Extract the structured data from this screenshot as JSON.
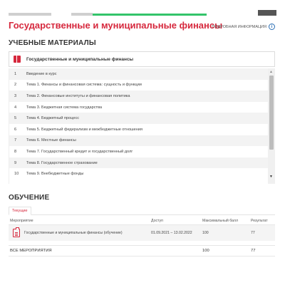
{
  "header": {
    "title": "Государственные и муниципальные финансы",
    "more_info": "ПОДРОБНАЯ ИНФОРМАЦИЯ"
  },
  "materials": {
    "heading": "УЧЕБНЫЕ МАТЕРИАЛЫ",
    "course_label": "Государственные и муниципальные финансы",
    "topics": [
      {
        "num": "1",
        "title": "Введение в курс"
      },
      {
        "num": "2",
        "title": "Тема 1. Финансы и финансовая система: сущность и функции"
      },
      {
        "num": "3",
        "title": "Тема 2. Финансовые институты и финансовая политика"
      },
      {
        "num": "4",
        "title": "Тема 3. Бюджетная система государства"
      },
      {
        "num": "5",
        "title": "Тема 4. Бюджетный процесс"
      },
      {
        "num": "6",
        "title": "Тема 5. Бюджетный федерализм и межбюджетные отношения"
      },
      {
        "num": "7",
        "title": "Тема 6. Местные финансы"
      },
      {
        "num": "8",
        "title": "Тема 7. Государственный кредит и государственный долг"
      },
      {
        "num": "9",
        "title": "Тема 8. Государственное страхование"
      },
      {
        "num": "10",
        "title": "Тема 9. Внебюджетные фонды"
      }
    ]
  },
  "learning": {
    "heading": "ОБУЧЕНИЕ",
    "tab_current": "Текущие",
    "columns": {
      "event": "Мероприятие",
      "access": "Доступ",
      "max_score": "Максимальный балл",
      "result": "Результат"
    },
    "rows": [
      {
        "event": "Государственные и муниципальные финансы (обучение)",
        "access": "01.09.2021 – 13.02.2022",
        "max_score": "100",
        "result": "77"
      }
    ],
    "total": {
      "label": "ВСЕ МЕРОПРИЯТИЯ",
      "max_score": "100",
      "result": "77"
    }
  },
  "colors": {
    "accent": "#d6283d",
    "progress": "#33c46a",
    "info": "#2b6fb5"
  }
}
